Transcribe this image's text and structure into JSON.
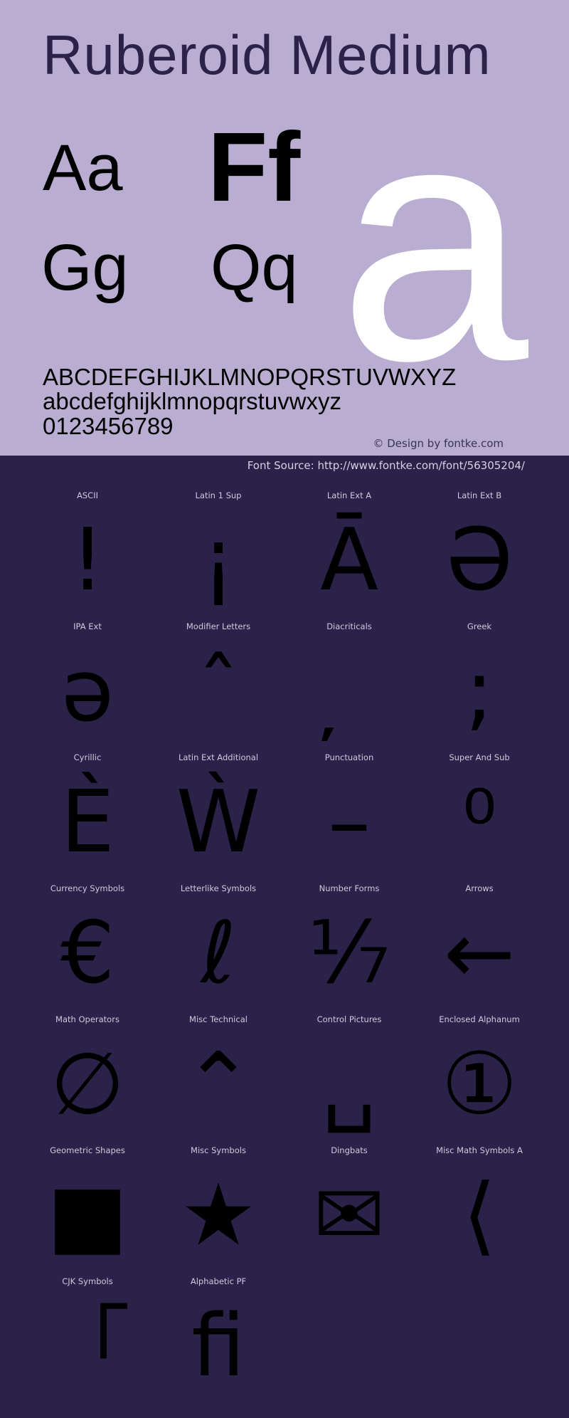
{
  "header": {
    "title": "Ruberoid Medium",
    "samples": [
      "Aa",
      "Ff",
      "Gg",
      "Qq"
    ],
    "big_glyph": "a",
    "uppercase": "ABCDEFGHIJKLMNOPQRSTUVWXYZ",
    "lowercase": "abcdefghijklmnopqrstuvwxyz",
    "digits": "0123456789",
    "credit": "© Design by fontke.com",
    "source": "Font Source: http://www.fontke.com/font/56305204/"
  },
  "colors": {
    "hero_bg": "#b9aed1",
    "page_bg": "#2a2248",
    "title": "#2a2248",
    "big_glyph": "#ffffff"
  },
  "blocks": [
    {
      "label": "ASCII",
      "glyph": "!"
    },
    {
      "label": "Latin 1 Sup",
      "glyph": "¡"
    },
    {
      "label": "Latin Ext A",
      "glyph": "Ā"
    },
    {
      "label": "Latin Ext B",
      "glyph": "Ə"
    },
    {
      "label": "IPA Ext",
      "glyph": "ə"
    },
    {
      "label": "Modifier Letters",
      "glyph": "ˆ"
    },
    {
      "label": "Diacriticals",
      "glyph": "̦"
    },
    {
      "label": "Greek",
      "glyph": ";"
    },
    {
      "label": "Cyrillic",
      "glyph": "Ѐ"
    },
    {
      "label": "Latin Ext Additional",
      "glyph": "Ẁ"
    },
    {
      "label": "Punctuation",
      "glyph": "–"
    },
    {
      "label": "Super And Sub",
      "glyph": "⁰"
    },
    {
      "label": "Currency Symbols",
      "glyph": "€"
    },
    {
      "label": "Letterlike Symbols",
      "glyph": "ℓ"
    },
    {
      "label": "Number Forms",
      "glyph": "⅐"
    },
    {
      "label": "Arrows",
      "glyph": "←"
    },
    {
      "label": "Math Operators",
      "glyph": "∅"
    },
    {
      "label": "Misc Technical",
      "glyph": "⌃"
    },
    {
      "label": "Control Pictures",
      "glyph": "␣"
    },
    {
      "label": "Enclosed Alphanum",
      "glyph": "①"
    },
    {
      "label": "Geometric Shapes",
      "glyph": "■"
    },
    {
      "label": "Misc Symbols",
      "glyph": "★"
    },
    {
      "label": "Dingbats",
      "glyph": "✉"
    },
    {
      "label": "Misc Math Symbols A",
      "glyph": "⟨"
    },
    {
      "label": "CJK Symbols",
      "glyph": "「"
    },
    {
      "label": "Alphabetic PF",
      "glyph": "ﬁ"
    }
  ]
}
